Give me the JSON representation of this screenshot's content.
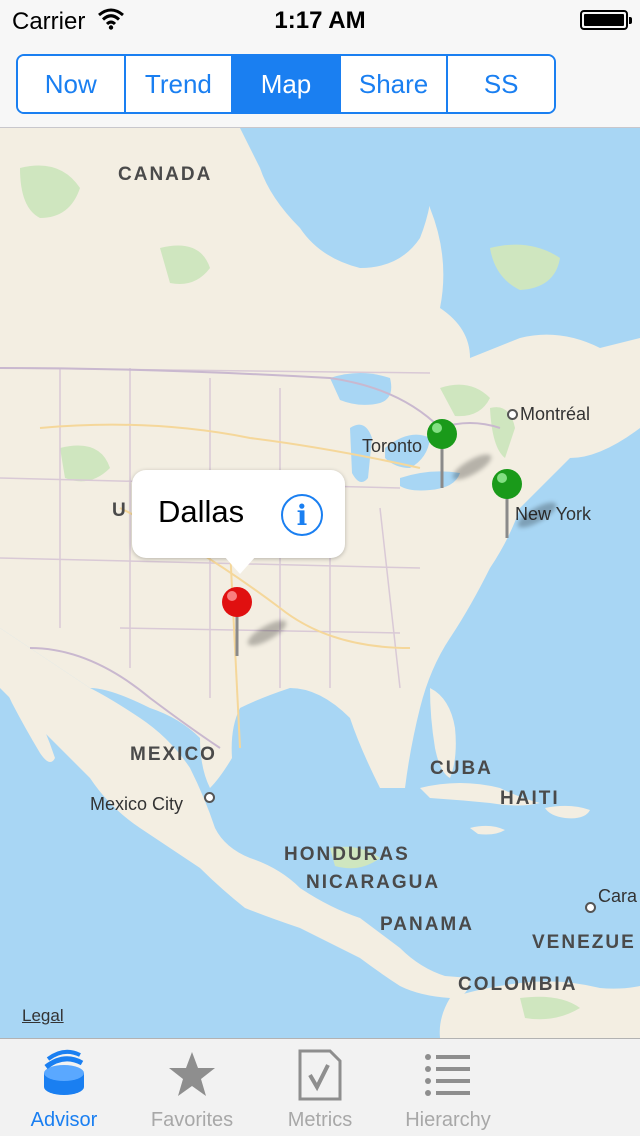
{
  "status_bar": {
    "carrier": "Carrier",
    "time": "1:17 AM"
  },
  "segments": [
    {
      "label": "Now",
      "selected": false
    },
    {
      "label": "Trend",
      "selected": false
    },
    {
      "label": "Map",
      "selected": true
    },
    {
      "label": "Share",
      "selected": false
    },
    {
      "label": "SS",
      "selected": false
    }
  ],
  "map": {
    "region_labels": {
      "canada": "CANADA",
      "united_states": "U",
      "mexico": "MEXICO",
      "cuba": "CUBA",
      "haiti": "HAITI",
      "honduras": "HONDURAS",
      "nicaragua": "NICARAGUA",
      "panama": "PANAMA",
      "venezuela": "VENEZUE",
      "colombia": "COLOMBIA"
    },
    "city_labels": {
      "toronto": "Toronto",
      "montreal": "Montréal",
      "new_york": "New York",
      "mexico_city": "Mexico City",
      "caracas": "Cara"
    },
    "callout_title": "Dallas",
    "legal": "Legal",
    "pin_colors": {
      "selected": "#e01010",
      "other": "#1a9a1a"
    }
  },
  "tabs": [
    {
      "label": "Advisor",
      "active": true
    },
    {
      "label": "Favorites",
      "active": false
    },
    {
      "label": "Metrics",
      "active": false
    },
    {
      "label": "Hierarchy",
      "active": false
    }
  ],
  "colors": {
    "accent": "#1a7ff1",
    "water": "#a8d6f4",
    "land": "#f3eee2"
  }
}
